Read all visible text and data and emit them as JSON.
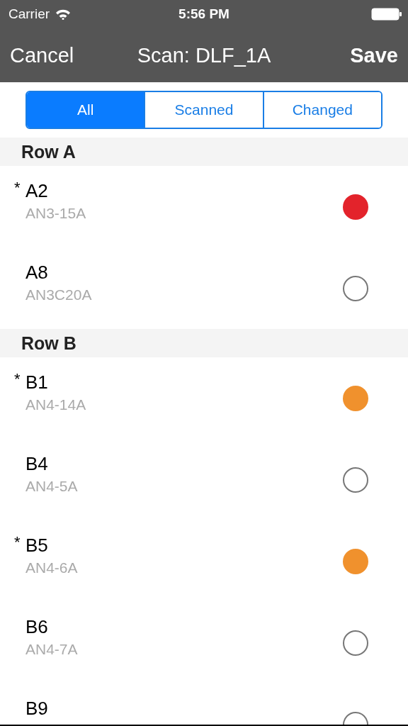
{
  "status_bar": {
    "carrier": "Carrier",
    "time": "5:56 PM"
  },
  "nav": {
    "cancel": "Cancel",
    "title": "Scan: DLF_1A",
    "save": "Save"
  },
  "tabs": [
    {
      "label": "All",
      "selected": true
    },
    {
      "label": "Scanned",
      "selected": false
    },
    {
      "label": "Changed",
      "selected": false
    }
  ],
  "sections": [
    {
      "title": "Row A",
      "items": [
        {
          "mark": "*",
          "name": "A2",
          "code": "AN3-15A",
          "kind": "dot",
          "color": "#e3232b"
        },
        {
          "name": "A8",
          "code": "AN3C20A",
          "kind": "empty"
        }
      ]
    },
    {
      "title": "Row B",
      "items": [
        {
          "mark": "*",
          "name": "B1",
          "code": "AN4-14A",
          "kind": "dot",
          "color": "#f0912d"
        },
        {
          "name": "B4",
          "code": "AN4-5A",
          "kind": "empty"
        },
        {
          "mark": "*",
          "name": "B5",
          "code": "AN4-6A",
          "kind": "dot",
          "color": "#f0912d"
        },
        {
          "name": "B6",
          "code": "AN4-7A",
          "kind": "empty"
        },
        {
          "name": "B9",
          "kind": "empty"
        }
      ]
    }
  ]
}
